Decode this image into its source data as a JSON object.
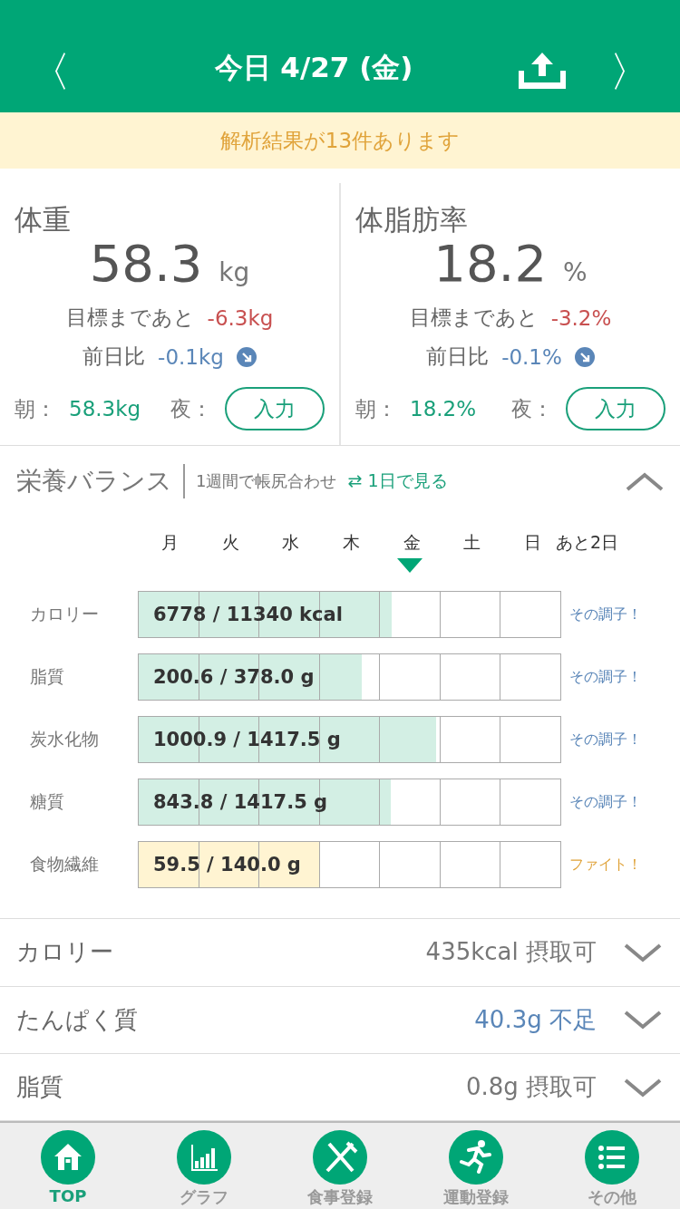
{
  "header": {
    "title": "今日 4/27 (金)",
    "prev": "〈",
    "next": "〉"
  },
  "banner": "解析結果が13件あります",
  "metrics": [
    {
      "title": "体重",
      "value": "58.3",
      "unit": "kg",
      "goal_label": "目標まであと",
      "goal": "-6.3kg",
      "diff_label": "前日比",
      "diff": "-0.1kg",
      "morning_label": "朝：",
      "morning": "58.3kg",
      "night_label": "夜：",
      "night_button": "入力"
    },
    {
      "title": "体脂肪率",
      "value": "18.2",
      "unit": "%",
      "goal_label": "目標まであと",
      "goal": "-3.2%",
      "diff_label": "前日比",
      "diff": "-0.1%",
      "morning_label": "朝：",
      "morning": "18.2%",
      "night_label": "夜：",
      "night_button": "入力"
    }
  ],
  "nutrition": {
    "title": "栄養バランス",
    "subtitle": "1週間で帳尻合わせ",
    "link": "⇄ 1日で見る",
    "expanded": true,
    "days": [
      {
        "label": "月",
        "selected": false
      },
      {
        "label": "火",
        "selected": false
      },
      {
        "label": "水",
        "selected": false
      },
      {
        "label": "木",
        "selected": false
      },
      {
        "label": "金",
        "selected": true
      },
      {
        "label": "土",
        "selected": false
      },
      {
        "label": "日",
        "selected": false
      }
    ],
    "remaining": "あと2日",
    "rows": [
      {
        "label": "カロリー",
        "value": "6778 / 11340 kcal",
        "level": 0.6,
        "kind": "ok",
        "status": "その調子！"
      },
      {
        "label": "脂質",
        "value": "200.6 / 378.0 g",
        "level": 0.53,
        "kind": "ok",
        "status": "その調子！"
      },
      {
        "label": "炭水化物",
        "value": "1000.9 / 1417.5 g",
        "level": 0.706,
        "kind": "ok",
        "status": "その調子！"
      },
      {
        "label": "糖質",
        "value": "843.8 / 1417.5 g",
        "level": 0.597,
        "kind": "ok",
        "status": "その調子！"
      },
      {
        "label": "食物繊維",
        "value": "59.5 / 140.0 g",
        "level": 0.429,
        "kind": "low",
        "status": "ファイト！"
      }
    ]
  },
  "summary": [
    {
      "label": "カロリー",
      "value": "435kcal 摂取可",
      "kind": "ok",
      "expanded": false
    },
    {
      "label": "たんぱく質",
      "value": "40.3g 不足",
      "kind": "low",
      "expanded": false
    },
    {
      "label": "脂質",
      "value": "0.8g 摂取可",
      "kind": "ok",
      "expanded": false
    }
  ],
  "tabs": [
    {
      "label": "TOP",
      "kind": "home",
      "selected": true
    },
    {
      "label": "グラフ",
      "kind": "graph",
      "selected": false
    },
    {
      "label": "食事登録",
      "kind": "meal",
      "selected": false
    },
    {
      "label": "運動登録",
      "kind": "exercise",
      "selected": false
    },
    {
      "label": "その他",
      "kind": "list",
      "selected": false
    }
  ]
}
